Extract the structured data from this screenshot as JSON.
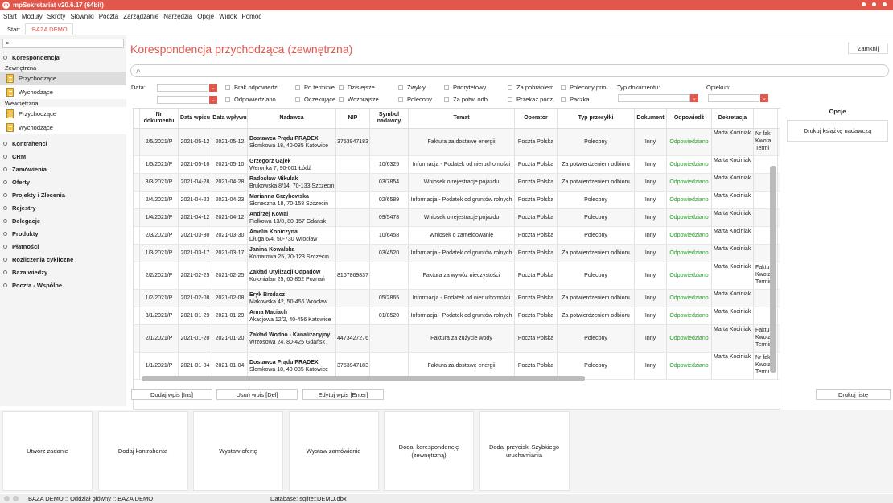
{
  "title": "mpSekretariat v20.6.17 (64bit)",
  "menu": [
    "Start",
    "Moduły",
    "Skróty",
    "Słowniki",
    "Poczta",
    "Zarządzanie",
    "Narzędzia",
    "Opcje",
    "Widok",
    "Pomoc"
  ],
  "tabs": [
    "Start",
    ":BAZA DEMO"
  ],
  "sidebar": {
    "korespondencja": "Korespondencja",
    "zewnetrzna": "Zewnętrzna",
    "wewnetrzna": "Wewnętrzna",
    "przychodzace": "Przychodzące",
    "wychodzace": "Wychodzące",
    "cats": [
      "Kontrahenci",
      "CRM",
      "Zamówienia",
      "Oferty",
      "Projekty i Zlecenia",
      "Rejestry",
      "Delegacje",
      "Produkty",
      "Płatności",
      "Rozliczenia cykliczne",
      "Baza wiedzy",
      "Poczta - Wspólne"
    ]
  },
  "page": {
    "title": "Korespondencja przychodząca (zewnętrzna)",
    "close": "Zamknij"
  },
  "filters": {
    "data": "Data:",
    "typ": "Typ dokumentu:",
    "opiekun": "Opiekun:",
    "checks": [
      [
        "Brak odpowiedzi",
        "Odpowiedziano"
      ],
      [
        "Po terminie",
        "Oczekujące"
      ],
      [
        "Dzisiejsze",
        "Wczorajsze"
      ],
      [
        "Zwykły",
        "Polecony"
      ],
      [
        "Priorytetowy",
        "Za potw. odb."
      ],
      [
        "Za pobraniem",
        "Przekaz pocz."
      ],
      [
        "Polecony prio.",
        "Paczka"
      ]
    ]
  },
  "columns": [
    "Nr dokumentu",
    "Data wpisu",
    "Data wpływu",
    "Nadawca",
    "NIP",
    "Symbol nadawcy",
    "Temat",
    "Operator",
    "Typ przesyłki",
    "Dokument",
    "Odpowiedź",
    "Dekretacja",
    ""
  ],
  "rows": [
    {
      "nr": "2/5/2021/P",
      "dw": "2021-05-12",
      "dp": "2021-05-12",
      "n1": "Dostawca Prądu PRĄDEX",
      "n2": "Słomkowa 18, 40-085 Katowice",
      "nip": "3753947183",
      "sym": "",
      "temat": "Faktura za dostawę energii",
      "op": "Poczta Polska",
      "typ": "Polecony",
      "dok": "Inny",
      "odp": "Odpowiedziano",
      "dek": "Marta Kociniak",
      "x": [
        "Nr fak",
        "Kwota",
        "Termi"
      ],
      "h": 34
    },
    {
      "nr": "1/5/2021/P",
      "dw": "2021-05-10",
      "dp": "2021-05-10",
      "n1": "Grzegorz Gajek",
      "n2": "Weronka 7, 90-001 Łódź",
      "nip": "",
      "sym": "10/6325",
      "temat": "Informacja - Podatek od nieruchomości",
      "op": "Poczta Polska",
      "typ": "Za potwierdzeniem odbioru",
      "dok": "Inny",
      "odp": "Odpowiedziano",
      "dek": "Marta Kociniak",
      "x": [],
      "h": 22
    },
    {
      "nr": "3/3/2021/P",
      "dw": "2021-04-28",
      "dp": "2021-04-28",
      "n1": "Radosław Mikulak",
      "n2": "Brukowska 8/14, 70-133 Szczecin",
      "nip": "",
      "sym": "03/7854",
      "temat": "Wniosek o rejestracje pojazdu",
      "op": "Poczta Polska",
      "typ": "Za potwierdzeniem odbioru",
      "dok": "Inny",
      "odp": "Odpowiedziano",
      "dek": "Marta Kociniak",
      "x": [],
      "h": 22
    },
    {
      "nr": "2/4/2021/P",
      "dw": "2021-04-23",
      "dp": "2021-04-23",
      "n1": "Marianna Grzybowska",
      "n2": "Słoneczna 18, 70-158 Szczecin",
      "nip": "",
      "sym": "02/6589",
      "temat": "Informacja - Podatek od gruntów rolnych",
      "op": "Poczta Polska",
      "typ": "Polecony",
      "dok": "Inny",
      "odp": "Odpowiedziano",
      "dek": "Marta Kociniak",
      "x": [],
      "h": 22
    },
    {
      "nr": "1/4/2021/P",
      "dw": "2021-04-12",
      "dp": "2021-04-12",
      "n1": "Andrzej Kowal",
      "n2": "Fiołkowa 13/8, 80-157 Gdańsk",
      "nip": "",
      "sym": "09/5478",
      "temat": "Wniosek o rejestracje pojazdu",
      "op": "Poczta Polska",
      "typ": "Polecony",
      "dok": "Inny",
      "odp": "Odpowiedziano",
      "dek": "Marta Kociniak",
      "x": [],
      "h": 22
    },
    {
      "nr": "2/3/2021/P",
      "dw": "2021-03-30",
      "dp": "2021-03-30",
      "n1": "Amelia Koniczyna",
      "n2": "Długa 6/4, 50-730 Wrocław",
      "nip": "",
      "sym": "10/6458",
      "temat": "Wniosek o zameldowanie",
      "op": "Poczta Polska",
      "typ": "Polecony",
      "dok": "Inny",
      "odp": "Odpowiedziano",
      "dek": "Marta Kociniak",
      "x": [],
      "h": 22
    },
    {
      "nr": "1/3/2021/P",
      "dw": "2021-03-17",
      "dp": "2021-03-17",
      "n1": "Janina Kowalska",
      "n2": "Komarowa 25, 70-123 Szczecin",
      "nip": "",
      "sym": "03/4520",
      "temat": "Informacja - Podatek od gruntów rolnych",
      "op": "Poczta Polska",
      "typ": "Za potwierdzeniem odbioru",
      "dok": "Inny",
      "odp": "Odpowiedziano",
      "dek": "Marta Kociniak",
      "x": [],
      "h": 22
    },
    {
      "nr": "2/2/2021/P",
      "dw": "2021-02-25",
      "dp": "2021-02-25",
      "n1": "Zakład Utylizacji Odpadów",
      "n2": "Kolonialan 25, 60-852 Poznań",
      "nip": "8167869837",
      "sym": "",
      "temat": "Faktura za wywóz nieczystości",
      "op": "Poczta Polska",
      "typ": "Polecony",
      "dok": "Inny",
      "odp": "Odpowiedziano",
      "dek": "Marta Kociniak",
      "x": [
        "Faktur",
        "Kwota",
        "Termin"
      ],
      "h": 34
    },
    {
      "nr": "1/2/2021/P",
      "dw": "2021-02-08",
      "dp": "2021-02-08",
      "n1": "Eryk Brzdącz",
      "n2": "Makowska 42, 50-456 Wrocław",
      "nip": "",
      "sym": "05/2865",
      "temat": "Informacja - Podatek od nieruchomości",
      "op": "Poczta Polska",
      "typ": "Za potwierdzeniem odbioru",
      "dok": "Inny",
      "odp": "Odpowiedziano",
      "dek": "Marta Kociniak",
      "x": [],
      "h": 22
    },
    {
      "nr": "3/1/2021/P",
      "dw": "2021-01-29",
      "dp": "2021-01-29",
      "n1": "Anna Maciach",
      "n2": "Akacjowa 12/2, 40-456 Katowice",
      "nip": "",
      "sym": "01/8520",
      "temat": "Informacja - Podatek od gruntów rolnych",
      "op": "Poczta Polska",
      "typ": "Za potwierdzeniem odbioru",
      "dok": "Inny",
      "odp": "Odpowiedziano",
      "dek": "Marta Kociniak",
      "x": [],
      "h": 22
    },
    {
      "nr": "2/1/2021/P",
      "dw": "2021-01-20",
      "dp": "2021-01-20",
      "n1": "Zakład Wodno - Kanalizacyjny",
      "n2": "Wrzosowa 24, 80-425 Gdańsk",
      "nip": "4473427276",
      "sym": "",
      "temat": "Faktura za zużycie wody",
      "op": "Poczta Polska",
      "typ": "Polecony",
      "dok": "Inny",
      "odp": "Odpowiedziano",
      "dek": "Marta Kociniak",
      "x": [
        "Faktur",
        "Kwota",
        "Termin"
      ],
      "h": 34
    },
    {
      "nr": "1/1/2021/P",
      "dw": "2021-01-04",
      "dp": "2021-01-04",
      "n1": "Dostawca Prądu PRĄDEX",
      "n2": "Słomkowa 18, 40-085 Katowice",
      "nip": "3753947183",
      "sym": "",
      "temat": "Faktura za dostawę energii",
      "op": "Poczta Polska",
      "typ": "Polecony",
      "dok": "Inny",
      "odp": "Odpowiedziano",
      "dek": "Marta Kociniak",
      "x": [
        "Nr fak",
        "Kwota",
        "Termi"
      ],
      "h": 34
    }
  ],
  "opcje": {
    "title": "Opcje",
    "print_book": "Drukuj książkę nadawczą"
  },
  "actions": {
    "add": "Dodaj wpis [Ins]",
    "del": "Usuń wpis [Del]",
    "edit": "Edytuj wpis [Enter]",
    "print": "Drukuj listę"
  },
  "quick": [
    "Utwórz zadanie",
    "Dodaj kontrahenta",
    "Wystaw ofertę",
    "Wystaw zamówienie",
    "Dodaj korespondencję (zewnętrzną)",
    "Dodaj przyciski Szybkiego uruchamiania"
  ],
  "status": {
    "left": "BAZA DEMO :: Oddział główny :: BAZA DEMO",
    "db": "Database: sqlite::DEMO.dbx"
  }
}
